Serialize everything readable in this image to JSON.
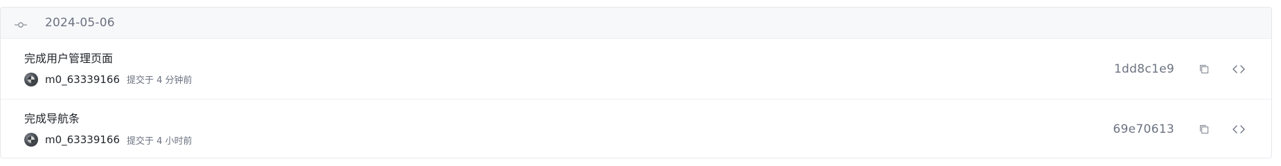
{
  "group": {
    "date": "2024-05-06"
  },
  "commits": [
    {
      "message": "完成用户管理页面",
      "author": "m0_63339166",
      "time": "提交于 4 分钟前",
      "sha": "1dd8c1e9"
    },
    {
      "message": "完成导航条",
      "author": "m0_63339166",
      "time": "提交于 4 小时前",
      "sha": "69e70613"
    }
  ],
  "icons": {
    "header": "commit-node-icon",
    "copy": "copy-icon",
    "browse": "code-brackets-icon"
  },
  "colors": {
    "header_bg": "#f7f8fa",
    "border": "#e5e7eb",
    "muted_text": "#6b7280",
    "primary_text": "#1f2328"
  }
}
